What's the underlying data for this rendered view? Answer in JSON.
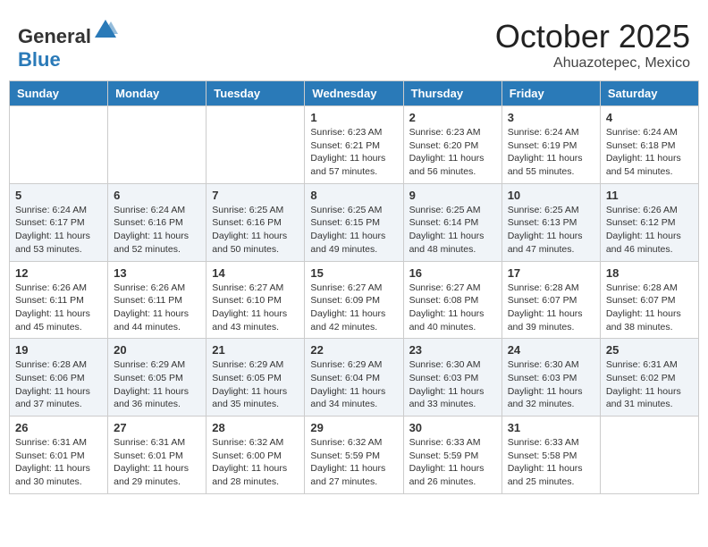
{
  "header": {
    "logo_general": "General",
    "logo_blue": "Blue",
    "month": "October 2025",
    "location": "Ahuazotepec, Mexico"
  },
  "weekdays": [
    "Sunday",
    "Monday",
    "Tuesday",
    "Wednesday",
    "Thursday",
    "Friday",
    "Saturday"
  ],
  "weeks": [
    [
      {
        "day": "",
        "sunrise": "",
        "sunset": "",
        "daylight": ""
      },
      {
        "day": "",
        "sunrise": "",
        "sunset": "",
        "daylight": ""
      },
      {
        "day": "",
        "sunrise": "",
        "sunset": "",
        "daylight": ""
      },
      {
        "day": "1",
        "sunrise": "Sunrise: 6:23 AM",
        "sunset": "Sunset: 6:21 PM",
        "daylight": "Daylight: 11 hours and 57 minutes."
      },
      {
        "day": "2",
        "sunrise": "Sunrise: 6:23 AM",
        "sunset": "Sunset: 6:20 PM",
        "daylight": "Daylight: 11 hours and 56 minutes."
      },
      {
        "day": "3",
        "sunrise": "Sunrise: 6:24 AM",
        "sunset": "Sunset: 6:19 PM",
        "daylight": "Daylight: 11 hours and 55 minutes."
      },
      {
        "day": "4",
        "sunrise": "Sunrise: 6:24 AM",
        "sunset": "Sunset: 6:18 PM",
        "daylight": "Daylight: 11 hours and 54 minutes."
      }
    ],
    [
      {
        "day": "5",
        "sunrise": "Sunrise: 6:24 AM",
        "sunset": "Sunset: 6:17 PM",
        "daylight": "Daylight: 11 hours and 53 minutes."
      },
      {
        "day": "6",
        "sunrise": "Sunrise: 6:24 AM",
        "sunset": "Sunset: 6:16 PM",
        "daylight": "Daylight: 11 hours and 52 minutes."
      },
      {
        "day": "7",
        "sunrise": "Sunrise: 6:25 AM",
        "sunset": "Sunset: 6:16 PM",
        "daylight": "Daylight: 11 hours and 50 minutes."
      },
      {
        "day": "8",
        "sunrise": "Sunrise: 6:25 AM",
        "sunset": "Sunset: 6:15 PM",
        "daylight": "Daylight: 11 hours and 49 minutes."
      },
      {
        "day": "9",
        "sunrise": "Sunrise: 6:25 AM",
        "sunset": "Sunset: 6:14 PM",
        "daylight": "Daylight: 11 hours and 48 minutes."
      },
      {
        "day": "10",
        "sunrise": "Sunrise: 6:25 AM",
        "sunset": "Sunset: 6:13 PM",
        "daylight": "Daylight: 11 hours and 47 minutes."
      },
      {
        "day": "11",
        "sunrise": "Sunrise: 6:26 AM",
        "sunset": "Sunset: 6:12 PM",
        "daylight": "Daylight: 11 hours and 46 minutes."
      }
    ],
    [
      {
        "day": "12",
        "sunrise": "Sunrise: 6:26 AM",
        "sunset": "Sunset: 6:11 PM",
        "daylight": "Daylight: 11 hours and 45 minutes."
      },
      {
        "day": "13",
        "sunrise": "Sunrise: 6:26 AM",
        "sunset": "Sunset: 6:11 PM",
        "daylight": "Daylight: 11 hours and 44 minutes."
      },
      {
        "day": "14",
        "sunrise": "Sunrise: 6:27 AM",
        "sunset": "Sunset: 6:10 PM",
        "daylight": "Daylight: 11 hours and 43 minutes."
      },
      {
        "day": "15",
        "sunrise": "Sunrise: 6:27 AM",
        "sunset": "Sunset: 6:09 PM",
        "daylight": "Daylight: 11 hours and 42 minutes."
      },
      {
        "day": "16",
        "sunrise": "Sunrise: 6:27 AM",
        "sunset": "Sunset: 6:08 PM",
        "daylight": "Daylight: 11 hours and 40 minutes."
      },
      {
        "day": "17",
        "sunrise": "Sunrise: 6:28 AM",
        "sunset": "Sunset: 6:07 PM",
        "daylight": "Daylight: 11 hours and 39 minutes."
      },
      {
        "day": "18",
        "sunrise": "Sunrise: 6:28 AM",
        "sunset": "Sunset: 6:07 PM",
        "daylight": "Daylight: 11 hours and 38 minutes."
      }
    ],
    [
      {
        "day": "19",
        "sunrise": "Sunrise: 6:28 AM",
        "sunset": "Sunset: 6:06 PM",
        "daylight": "Daylight: 11 hours and 37 minutes."
      },
      {
        "day": "20",
        "sunrise": "Sunrise: 6:29 AM",
        "sunset": "Sunset: 6:05 PM",
        "daylight": "Daylight: 11 hours and 36 minutes."
      },
      {
        "day": "21",
        "sunrise": "Sunrise: 6:29 AM",
        "sunset": "Sunset: 6:05 PM",
        "daylight": "Daylight: 11 hours and 35 minutes."
      },
      {
        "day": "22",
        "sunrise": "Sunrise: 6:29 AM",
        "sunset": "Sunset: 6:04 PM",
        "daylight": "Daylight: 11 hours and 34 minutes."
      },
      {
        "day": "23",
        "sunrise": "Sunrise: 6:30 AM",
        "sunset": "Sunset: 6:03 PM",
        "daylight": "Daylight: 11 hours and 33 minutes."
      },
      {
        "day": "24",
        "sunrise": "Sunrise: 6:30 AM",
        "sunset": "Sunset: 6:03 PM",
        "daylight": "Daylight: 11 hours and 32 minutes."
      },
      {
        "day": "25",
        "sunrise": "Sunrise: 6:31 AM",
        "sunset": "Sunset: 6:02 PM",
        "daylight": "Daylight: 11 hours and 31 minutes."
      }
    ],
    [
      {
        "day": "26",
        "sunrise": "Sunrise: 6:31 AM",
        "sunset": "Sunset: 6:01 PM",
        "daylight": "Daylight: 11 hours and 30 minutes."
      },
      {
        "day": "27",
        "sunrise": "Sunrise: 6:31 AM",
        "sunset": "Sunset: 6:01 PM",
        "daylight": "Daylight: 11 hours and 29 minutes."
      },
      {
        "day": "28",
        "sunrise": "Sunrise: 6:32 AM",
        "sunset": "Sunset: 6:00 PM",
        "daylight": "Daylight: 11 hours and 28 minutes."
      },
      {
        "day": "29",
        "sunrise": "Sunrise: 6:32 AM",
        "sunset": "Sunset: 5:59 PM",
        "daylight": "Daylight: 11 hours and 27 minutes."
      },
      {
        "day": "30",
        "sunrise": "Sunrise: 6:33 AM",
        "sunset": "Sunset: 5:59 PM",
        "daylight": "Daylight: 11 hours and 26 minutes."
      },
      {
        "day": "31",
        "sunrise": "Sunrise: 6:33 AM",
        "sunset": "Sunset: 5:58 PM",
        "daylight": "Daylight: 11 hours and 25 minutes."
      },
      {
        "day": "",
        "sunrise": "",
        "sunset": "",
        "daylight": ""
      }
    ]
  ],
  "colors": {
    "header_bg": "#2a7ab8",
    "shaded_row": "#f0f4f8",
    "white_row": "#ffffff"
  }
}
